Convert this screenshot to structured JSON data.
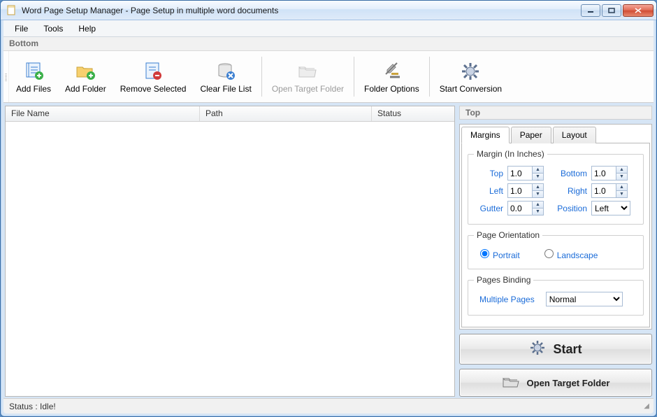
{
  "window": {
    "title": "Word Page Setup Manager - Page Setup in multiple word documents"
  },
  "menu": {
    "file": "File",
    "tools": "Tools",
    "help": "Help"
  },
  "panel": {
    "bottom_label": "Bottom",
    "top_label": "Top"
  },
  "toolbar": {
    "add_files": "Add Files",
    "add_folder": "Add Folder",
    "remove_selected": "Remove Selected",
    "clear_list": "Clear File List",
    "open_target": "Open Target Folder",
    "folder_options": "Folder Options",
    "start_conversion": "Start Conversion"
  },
  "columns": {
    "file_name": "File Name",
    "path": "Path",
    "status": "Status"
  },
  "tabs": {
    "margins": "Margins",
    "paper": "Paper",
    "layout": "Layout"
  },
  "margins": {
    "group_label": "Margin (In Inches)",
    "top_label": "Top",
    "top_value": "1.0",
    "bottom_label": "Bottom",
    "bottom_value": "1.0",
    "left_label": "Left",
    "left_value": "1.0",
    "right_label": "Right",
    "right_value": "1.0",
    "gutter_label": "Gutter",
    "gutter_value": "0.0",
    "position_label": "Position",
    "position_value": "Left"
  },
  "orientation": {
    "group_label": "Page Orientation",
    "portrait": "Portrait",
    "landscape": "Landscape",
    "selected": "portrait"
  },
  "binding": {
    "group_label": "Pages Binding",
    "label": "Multiple Pages",
    "value": "Normal"
  },
  "buttons": {
    "start": "Start",
    "open_target": "Open Target Folder"
  },
  "status": {
    "text": "Status  :  Idle!"
  }
}
